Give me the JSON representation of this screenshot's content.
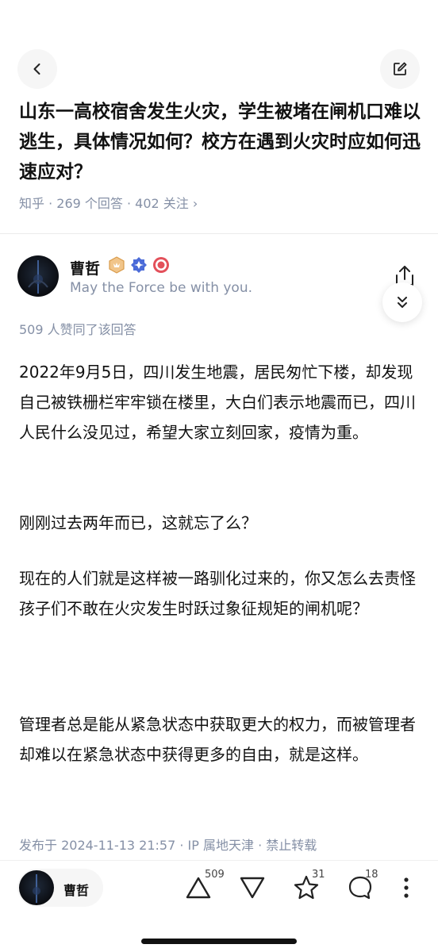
{
  "question": {
    "title": "山东一高校宿舍发生火灾，学生被堵在闸机口难以逃生，具体情况如何？校方在遇到火灾时应如何迅速应对？",
    "meta": "知乎 · 269 个回答 · 402 关注 ›"
  },
  "author": {
    "name": "曹哲",
    "bio": "May the Force be with you.",
    "badges": [
      "gold-badge-icon",
      "blue-verified-icon",
      "red-badge-icon"
    ]
  },
  "answer": {
    "votes_note": "509 人赞同了该回答",
    "paragraphs": [
      "2022年9月5日，四川发生地震，居民匆忙下楼，却发现自己被铁栅栏牢牢锁在楼里，大白们表示地震而已，四川人民什么没见过，希望大家立刻回家，疫情为重。",
      "刚刚过去两年而已，这就忘了么？",
      "现在的人们就是这样被一路驯化过来的，你又怎么去责怪孩子们不敢在火灾发生时跃过象征规矩的闸机呢？",
      "管理者总是能从紧急状态中获取更大的权力，而被管理者却难以在紧急状态中获得更多的自由，就是这样。"
    ],
    "publish_info": "发布于 2024-11-13 21:57 · IP 属地天津 · 禁止转载"
  },
  "bottom_bar": {
    "author_name": "曹哲",
    "upvote_count": "509",
    "favorite_count": "31",
    "comment_count": "18"
  }
}
